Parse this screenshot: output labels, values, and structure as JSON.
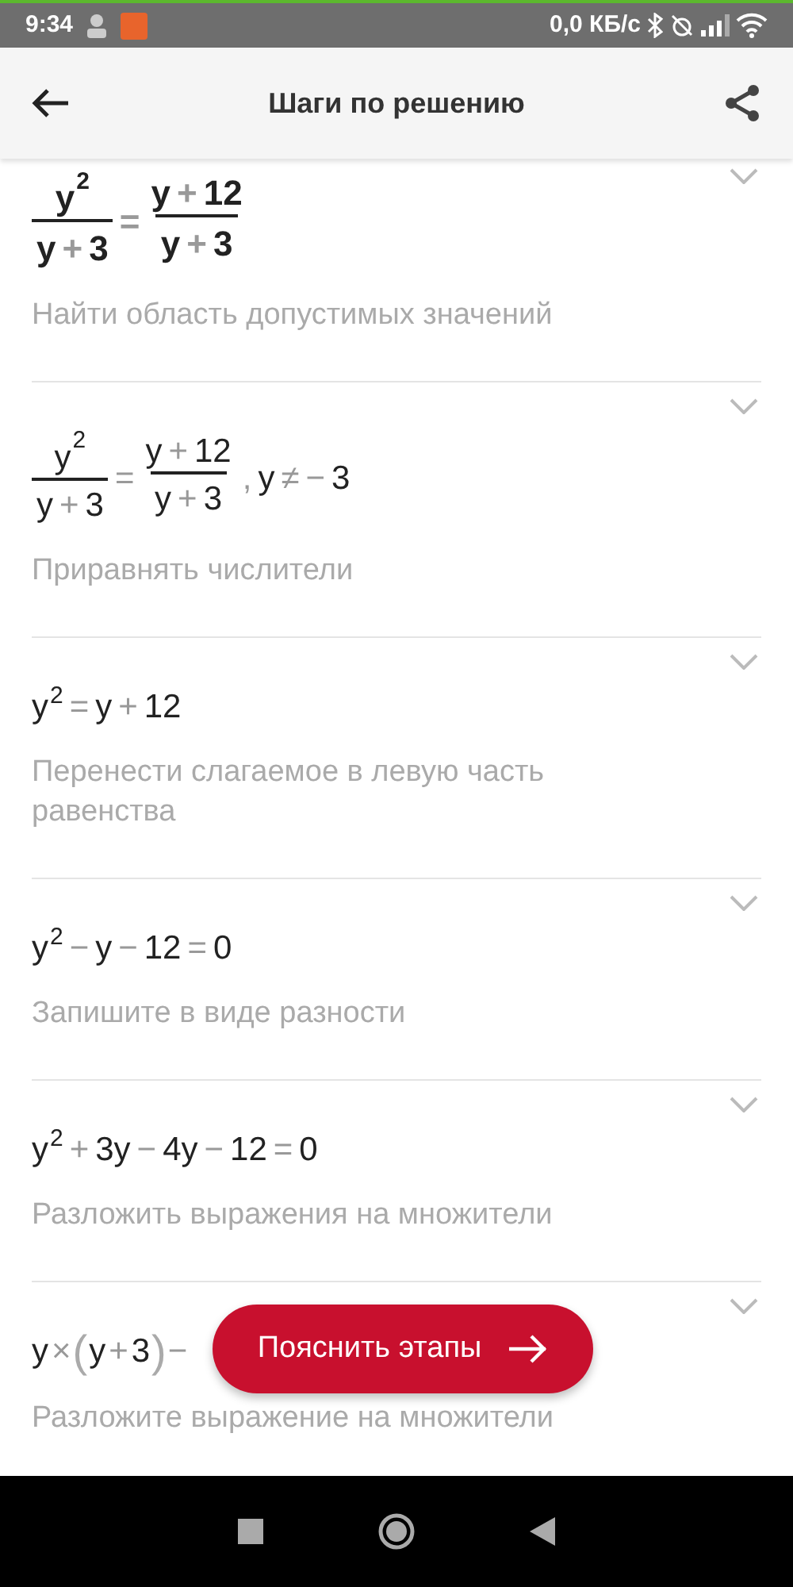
{
  "status_bar": {
    "time": "9:34",
    "network_speed": "0,0 КБ/с"
  },
  "header": {
    "title": "Шаги по решению"
  },
  "steps": [
    {
      "kind": "problem",
      "formula": [
        {
          "kind": "frac",
          "num": [
            {
              "kind": "v",
              "text": "y"
            },
            {
              "kind": "sup",
              "text": "2"
            }
          ],
          "den": [
            {
              "kind": "v",
              "text": "y"
            },
            {
              "kind": "op",
              "text": "+"
            },
            {
              "kind": "v",
              "text": "3"
            }
          ]
        },
        {
          "kind": "op",
          "text": "="
        },
        {
          "kind": "frac",
          "num": [
            {
              "kind": "v",
              "text": "y"
            },
            {
              "kind": "op",
              "text": "+"
            },
            {
              "kind": "v",
              "text": "12"
            }
          ],
          "den": [
            {
              "kind": "v",
              "text": "y"
            },
            {
              "kind": "op",
              "text": "+"
            },
            {
              "kind": "v",
              "text": "3"
            }
          ]
        }
      ],
      "description": "Найти область допустимых значений"
    },
    {
      "kind": "step",
      "formula": [
        {
          "kind": "frac",
          "num": [
            {
              "kind": "v",
              "text": "y"
            },
            {
              "kind": "sup",
              "text": "2"
            }
          ],
          "den": [
            {
              "kind": "v",
              "text": "y"
            },
            {
              "kind": "op",
              "text": "+"
            },
            {
              "kind": "v",
              "text": "3"
            }
          ]
        },
        {
          "kind": "op",
          "text": "="
        },
        {
          "kind": "frac",
          "num": [
            {
              "kind": "v",
              "text": "y"
            },
            {
              "kind": "op",
              "text": "+"
            },
            {
              "kind": "v",
              "text": "12"
            }
          ],
          "den": [
            {
              "kind": "v",
              "text": "y"
            },
            {
              "kind": "op",
              "text": "+"
            },
            {
              "kind": "v",
              "text": "3"
            }
          ]
        },
        {
          "kind": "op",
          "text": ","
        },
        {
          "kind": "v",
          "text": "y"
        },
        {
          "kind": "op",
          "text": "≠"
        },
        {
          "kind": "op",
          "text": "−"
        },
        {
          "kind": "v",
          "text": "3"
        }
      ],
      "description": "Приравнять числители"
    },
    {
      "kind": "step",
      "formula": [
        {
          "kind": "v",
          "text": "y"
        },
        {
          "kind": "sup",
          "text": "2"
        },
        {
          "kind": "op",
          "text": "="
        },
        {
          "kind": "v",
          "text": "y"
        },
        {
          "kind": "op",
          "text": "+"
        },
        {
          "kind": "v",
          "text": "12"
        }
      ],
      "description": "Перенести слагаемое в левую часть равенства"
    },
    {
      "kind": "step",
      "formula": [
        {
          "kind": "v",
          "text": "y"
        },
        {
          "kind": "sup",
          "text": "2"
        },
        {
          "kind": "op",
          "text": "−"
        },
        {
          "kind": "v",
          "text": "y"
        },
        {
          "kind": "op",
          "text": "−"
        },
        {
          "kind": "v",
          "text": "12"
        },
        {
          "kind": "op",
          "text": "="
        },
        {
          "kind": "v",
          "text": "0"
        }
      ],
      "description": "Запишите в виде разности"
    },
    {
      "kind": "step",
      "formula": [
        {
          "kind": "v",
          "text": "y"
        },
        {
          "kind": "sup",
          "text": "2"
        },
        {
          "kind": "op",
          "text": "+"
        },
        {
          "kind": "v",
          "text": "3y"
        },
        {
          "kind": "op",
          "text": "−"
        },
        {
          "kind": "v",
          "text": "4y"
        },
        {
          "kind": "op",
          "text": "−"
        },
        {
          "kind": "v",
          "text": "12"
        },
        {
          "kind": "op",
          "text": "="
        },
        {
          "kind": "v",
          "text": "0"
        }
      ],
      "description": "Разложить выражения на множители"
    },
    {
      "kind": "step",
      "formula": [
        {
          "kind": "v",
          "text": "y"
        },
        {
          "kind": "op",
          "text": "×"
        },
        {
          "kind": "paren",
          "text": "("
        },
        {
          "kind": "v",
          "text": "y"
        },
        {
          "kind": "op",
          "text": "+"
        },
        {
          "kind": "v",
          "text": "3"
        },
        {
          "kind": "paren",
          "text": ")"
        },
        {
          "kind": "op",
          "text": "−"
        }
      ],
      "description": "Разложите выражение на множители"
    }
  ],
  "explain_button": {
    "label": "Пояснить этапы"
  }
}
